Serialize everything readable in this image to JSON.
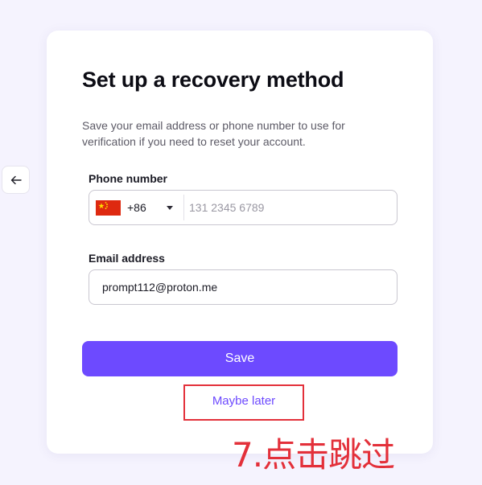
{
  "header": {
    "title": "Set up a recovery method",
    "subtitle": "Save your email address or phone number to use for verification if you need to reset your account."
  },
  "nav": {
    "back_icon": "arrow-left-icon"
  },
  "phone": {
    "label": "Phone number",
    "country_flag": "china-flag-icon",
    "country_code": "+86",
    "placeholder": "131 2345 6789",
    "value": ""
  },
  "email": {
    "label": "Email address",
    "value": "prompt112@proton.me"
  },
  "actions": {
    "save_label": "Save",
    "later_label": "Maybe later"
  },
  "annotation": {
    "text": "7.点击跳过"
  },
  "colors": {
    "accent": "#6d4aff",
    "annotation_red": "#e3303a",
    "background": "#f5f3fe"
  }
}
